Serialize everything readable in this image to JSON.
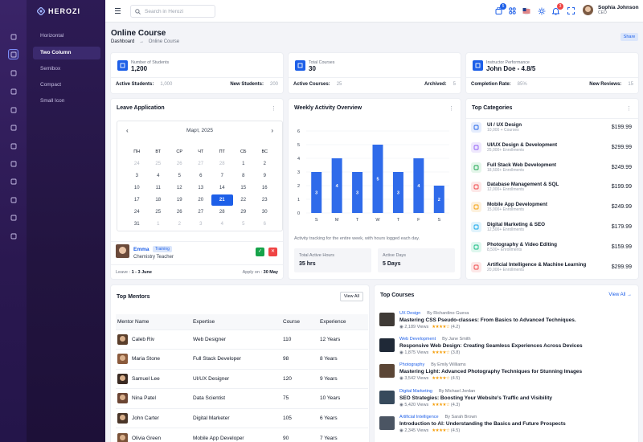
{
  "brand": "HEROZI",
  "sidebar_sub": [
    "Horizontal",
    "Two Column",
    "Semibox",
    "Compact",
    "Small Icon"
  ],
  "sidebar_active": 1,
  "sidebar_icons": [
    "home-icon",
    "layout-icon",
    "grid-icon",
    "layers-icon",
    "bell-icon",
    "calendar-icon",
    "megaphone-icon",
    "table-icon",
    "clock-icon",
    "map-icon",
    "terminal-icon",
    "users-icon"
  ],
  "search_placeholder": "Search in Herozi",
  "topbar": {
    "cart_badge": "5",
    "notif_badge": "3",
    "user_name": "Sophia Johnson",
    "user_role": "CEO"
  },
  "page": {
    "title": "Online Course",
    "crumb_root": "Dashboard",
    "crumb_sep": "→",
    "crumb_current": "Online Course",
    "share": "Share"
  },
  "stats": [
    {
      "label": "Number of Students",
      "value": "1,200",
      "f1": "Active Students:",
      "v1": "1,000",
      "f2": "New Students:",
      "v2": "200"
    },
    {
      "label": "Total Courses",
      "value": "30",
      "f1": "Active Courses:",
      "v1": "25",
      "f2": "Archived:",
      "v2": "5"
    },
    {
      "label": "Instructor Performance",
      "value": "John Doe - 4.8/5",
      "f1": "Completion Rate:",
      "v1": "85%",
      "f2": "New Reviews:",
      "v2": "15"
    }
  ],
  "leave": {
    "title": "Leave Application",
    "month": "Март, 2025",
    "weekdays": [
      "ПН",
      "ВТ",
      "СР",
      "ЧТ",
      "ПТ",
      "СБ",
      "ВС"
    ],
    "weeks": [
      [
        "24",
        "25",
        "26",
        "27",
        "28",
        "1",
        "2"
      ],
      [
        "3",
        "4",
        "5",
        "6",
        "7",
        "8",
        "9"
      ],
      [
        "10",
        "11",
        "12",
        "13",
        "14",
        "15",
        "16"
      ],
      [
        "17",
        "18",
        "19",
        "20",
        "21",
        "22",
        "23"
      ],
      [
        "24",
        "25",
        "26",
        "27",
        "28",
        "29",
        "30"
      ],
      [
        "31",
        "1",
        "2",
        "3",
        "4",
        "5",
        "6"
      ]
    ],
    "name": "Emma",
    "tag": "Training",
    "role": "Chemistry Teacher",
    "leave_label": "Leave :",
    "leave_range": "1 - 3 June",
    "apply_label": "Apply on :",
    "apply_date": "30 May"
  },
  "weekly": {
    "title": "Weekly Activity Overview",
    "note": "Activity tracking for the entire week, with hours logged each day.",
    "b1_label": "Total Active Hours",
    "b1_value": "35 hrs",
    "b2_label": "Active Days",
    "b2_value": "5 Days"
  },
  "chart_data": {
    "type": "bar",
    "categories": [
      "S",
      "M",
      "T",
      "W",
      "T",
      "F",
      "S"
    ],
    "values": [
      3,
      4,
      3,
      5,
      3,
      4,
      2
    ],
    "ylim": [
      0,
      6
    ],
    "yticks": [
      0,
      1,
      2,
      3,
      4,
      5,
      6
    ],
    "bar_color": "#2f6bea"
  },
  "categories": {
    "title": "Top Categories",
    "items": [
      {
        "name": "UI / UX Design",
        "sub": "10,000 + Courses",
        "price": "$199.99",
        "icon": "grid-icon",
        "color": "#1d5fe8",
        "bg": "#e5edfd"
      },
      {
        "name": "UI/UX Design & Development",
        "sub": "25,000+ Enrollments",
        "price": "$299.99",
        "icon": "pen-icon",
        "color": "#8b5cf6",
        "bg": "#efe8fd"
      },
      {
        "name": "Full Stack Web Development",
        "sub": "18,500+ Enrollments",
        "price": "$249.99",
        "icon": "code-icon",
        "color": "#16a34a",
        "bg": "#e4f6ea"
      },
      {
        "name": "Database Management & SQL",
        "sub": "12,000+ Enrollments",
        "price": "$199.99",
        "icon": "database-icon",
        "color": "#ef4444",
        "bg": "#fde8e8"
      },
      {
        "name": "Mobile App Development",
        "sub": "15,000+ Enrollments",
        "price": "$249.99",
        "icon": "mobile-icon",
        "color": "#f59e0b",
        "bg": "#fdf1dd"
      },
      {
        "name": "Digital Marketing & SEO",
        "sub": "12,500+ Enrollments",
        "price": "$179.99",
        "icon": "search-icon",
        "color": "#0ea5e9",
        "bg": "#e0f3fc"
      },
      {
        "name": "Photography & Video Editing",
        "sub": "8,500+ Enrollments",
        "price": "$159.99",
        "icon": "camera-icon",
        "color": "#10b981",
        "bg": "#def7ee"
      },
      {
        "name": "Artificial Intelligence & Machine Learning",
        "sub": "20,000+ Enrollments",
        "price": "$299.99",
        "icon": "robot-icon",
        "color": "#ef4444",
        "bg": "#fde8e8"
      }
    ]
  },
  "mentors": {
    "title": "Top Mentors",
    "view_all": "View All",
    "headers": [
      "Mentor Name",
      "Expertise",
      "Course",
      "Experience"
    ],
    "rows": [
      [
        "Caleb Riv",
        "Web Designer",
        "110",
        "12 Years"
      ],
      [
        "Maria Stone",
        "Full Stack Developer",
        "98",
        "8 Years"
      ],
      [
        "Samuel Lee",
        "UI/UX Designer",
        "120",
        "9 Years"
      ],
      [
        "Nina Patel",
        "Data Scientist",
        "75",
        "10 Years"
      ],
      [
        "John Carter",
        "Digital Marketer",
        "105",
        "6 Years"
      ],
      [
        "Olivia Green",
        "Mobile App Developer",
        "90",
        "7 Years"
      ]
    ]
  },
  "courses": {
    "title": "Top Courses",
    "view_all": "View All →",
    "items": [
      {
        "cat": "UX Design",
        "by": "By Richardino Gueva",
        "name": "Mastering CSS Pseudo-classes: From Basics to Advanced Techniques.",
        "views": "2,189 Views",
        "rating": "(4.2)",
        "thumb": "#3f3a36"
      },
      {
        "cat": "Web Development",
        "by": "By Jane Smith",
        "name": "Responsive Web Design: Creating Seamless Experiences Across Devices",
        "views": "1,875 Views",
        "rating": "(3.8)",
        "thumb": "#1f2937"
      },
      {
        "cat": "Photography",
        "by": "By Emily Williams",
        "name": "Mastering Light: Advanced Photography Techniques for Stunning Images",
        "views": "3,542 Views",
        "rating": "(4.5)",
        "thumb": "#5b4636"
      },
      {
        "cat": "Digital Marketing",
        "by": "By Michael Jordan",
        "name": "SEO Strategies: Boosting Your Website's Traffic and Visibility",
        "views": "5,420 Views",
        "rating": "(4.3)",
        "thumb": "#374a5c"
      },
      {
        "cat": "Artificial Intelligence",
        "by": "By Sarah Brown",
        "name": "Introduction to AI: Understanding the Basics and Future Prospects",
        "views": "2,345 Views",
        "rating": "(4.5)",
        "thumb": "#4b5563"
      }
    ]
  }
}
